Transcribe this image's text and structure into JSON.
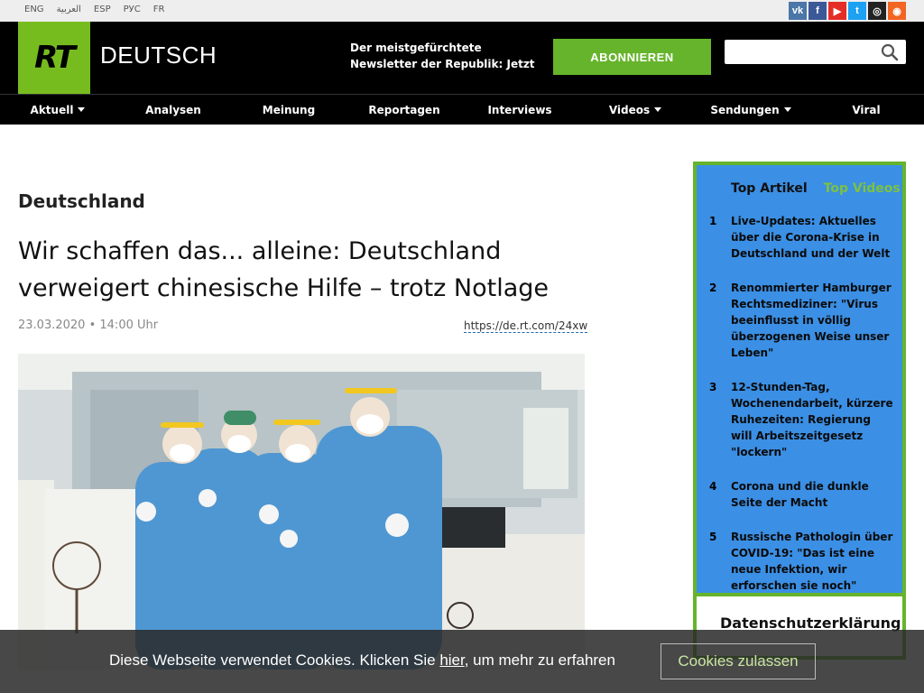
{
  "languages": [
    "ENG",
    "العربية",
    "ESP",
    "РУС",
    "FR"
  ],
  "socials": [
    {
      "icon": "vk-icon",
      "glyph": "vk",
      "color": "#4a76a8"
    },
    {
      "icon": "facebook-icon",
      "glyph": "f",
      "color": "#3b5998"
    },
    {
      "icon": "youtube-icon",
      "glyph": "▶",
      "color": "#e52d27"
    },
    {
      "icon": "twitter-icon",
      "glyph": "t",
      "color": "#1da1f2"
    },
    {
      "icon": "instagram-icon",
      "glyph": "◎",
      "color": "#222222"
    },
    {
      "icon": "rss-icon",
      "glyph": "◉",
      "color": "#f26522"
    }
  ],
  "header": {
    "logo": "RT",
    "brand": "DEUTSCH",
    "newsletter": "Der meistgefürchtete Newsletter der Republik: Jetzt",
    "subscribe_label": "ABONNIEREN",
    "search_placeholder": ""
  },
  "nav": [
    {
      "label": "Aktuell",
      "dropdown": true
    },
    {
      "label": "Analysen",
      "dropdown": false
    },
    {
      "label": "Meinung",
      "dropdown": false
    },
    {
      "label": "Reportagen",
      "dropdown": false
    },
    {
      "label": "Interviews",
      "dropdown": false
    },
    {
      "label": "Videos",
      "dropdown": true
    },
    {
      "label": "Sendungen",
      "dropdown": true
    },
    {
      "label": "Viral",
      "dropdown": false
    }
  ],
  "article": {
    "section": "Deutschland",
    "headline": "Wir schaffen das... alleine: Deutschland verweigert chinesische Hilfe – trotz Notlage",
    "date": "23.03.2020",
    "time": "14:00 Uhr",
    "shortlink": "https://de.rt.com/24xw"
  },
  "sidebar": {
    "tab_articles": "Top Artikel",
    "tab_videos": "Top Videos",
    "items": [
      {
        "num": "1",
        "text": "Live-Updates: Aktuelles über die Corona-Krise in Deutschland und der Welt"
      },
      {
        "num": "2",
        "text": "Renommierter Hamburger Rechtsmediziner: \"Virus beeinflusst in völlig überzogenen Weise unser Leben\""
      },
      {
        "num": "3",
        "text": "12-Stunden-Tag, Wochenendarbeit, kürzere Ruhezeiten: Regierung will Arbeitszeitgesetz \"lockern\""
      },
      {
        "num": "4",
        "text": "Corona und die dunkle Seite der Macht"
      },
      {
        "num": "5",
        "text": "Russische Pathologin über COVID-19: \"Das ist eine neue Infektion, wir erforschen sie noch\""
      }
    ],
    "privacy_title": "Datenschutzerklärung"
  },
  "cookie": {
    "text_before": "Diese Webseite verwendet Cookies. Klicken Sie ",
    "link": "hier",
    "text_after": ", um mehr zu erfahren",
    "button": "Cookies zulassen"
  },
  "colors": {
    "brand_green": "#77bc1f",
    "button_green": "#66b42c",
    "sidebar_blue": "#3b8fe4"
  }
}
